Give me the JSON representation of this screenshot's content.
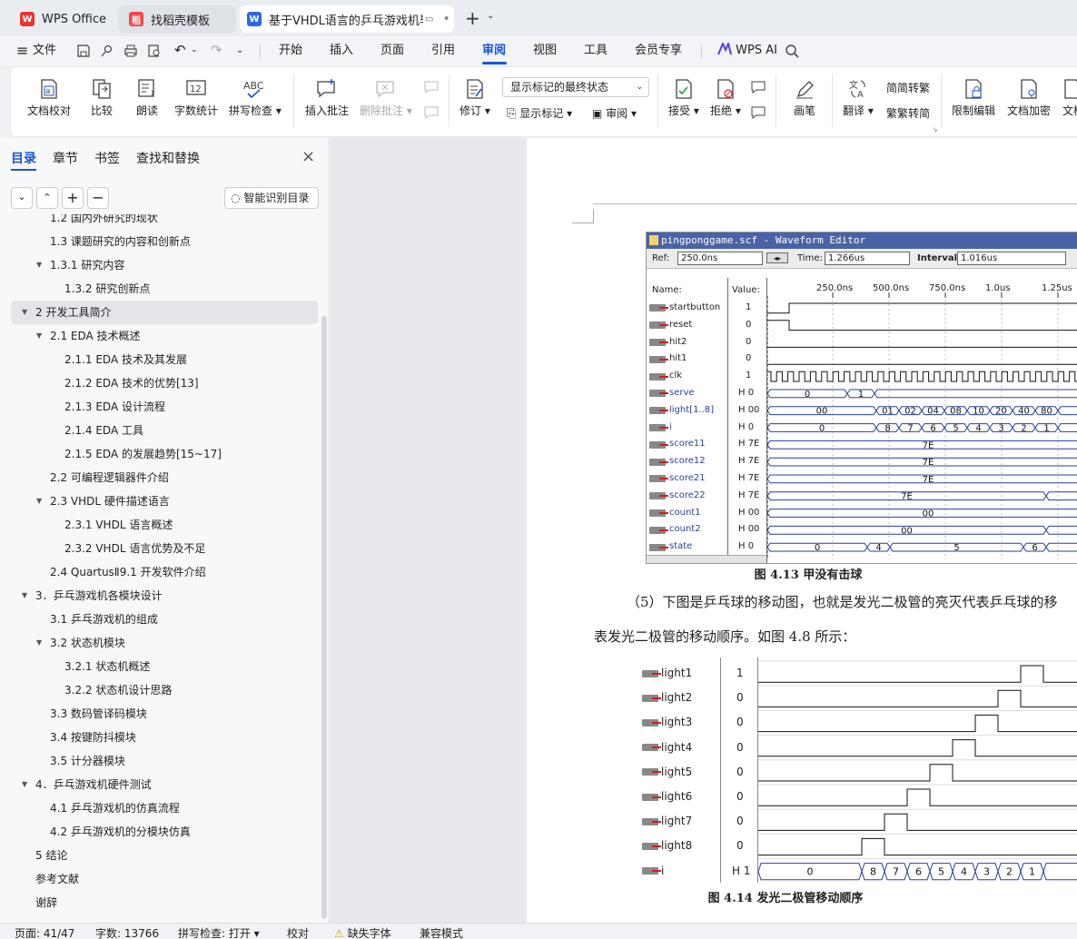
{
  "tabs": [
    {
      "label": "WPS Office",
      "icon": "wps-logo"
    },
    {
      "label": "找稻壳模板",
      "icon": "docer-logo"
    },
    {
      "label": "基于VHDL语言的乒乓游戏机毕",
      "icon": "word-doc"
    }
  ],
  "menu": {
    "file": "文件",
    "items": [
      "开始",
      "插入",
      "页面",
      "引用",
      "审阅",
      "视图",
      "工具",
      "会员专享"
    ],
    "active": "审阅",
    "ai": "WPS AI"
  },
  "ribbon": {
    "doc_check": "文档校对",
    "compare": "比较",
    "read_aloud": "朗读",
    "word_count": "字数统计",
    "spell_check": "拼写检查",
    "insert_comment": "插入批注",
    "delete_comment": "删除批注",
    "track": "修订",
    "markup_dropdown": "显示标记的最终状态",
    "show_markup": "显示标记",
    "review": "审阅",
    "accept": "接受",
    "reject": "拒绝",
    "pen": "画笔",
    "translate": "翻译",
    "to_traditional": "简转繁",
    "to_simplified": "繁转简",
    "restrict": "限制编辑",
    "encrypt": "文档加密",
    "doc_more": "文档"
  },
  "sidebar": {
    "tabs": [
      "目录",
      "章节",
      "书签",
      "查找和替换"
    ],
    "smart_button": "智能识别目录",
    "toc": [
      {
        "label": "1.2 国内外研究的现状",
        "level": 1
      },
      {
        "label": "1.3 课题研究的内容和创新点",
        "level": 1
      },
      {
        "label": "1.3.1  研究内容",
        "level": 1,
        "exp": true
      },
      {
        "label": "1.3.2  研究创新点",
        "level": 2
      },
      {
        "label": "2  开发工具简介",
        "level": 0,
        "exp": true
      },
      {
        "label": "2.1 EDA 技术概述",
        "level": 1,
        "exp": true
      },
      {
        "label": "2.1.1 EDA 技术及其发展",
        "level": 2
      },
      {
        "label": "2.1.2 EDA 技术的优势[13]",
        "level": 2
      },
      {
        "label": "2.1.3 EDA 设计流程",
        "level": 2
      },
      {
        "label": "2.1.4 EDA 工具",
        "level": 2
      },
      {
        "label": "2.1.5 EDA 的发展趋势[15~17]",
        "level": 2
      },
      {
        "label": "2.2 可编程逻辑器件介绍",
        "level": 1
      },
      {
        "label": "2.3 VHDL 硬件描述语言",
        "level": 1,
        "exp": true
      },
      {
        "label": "2.3.1 VHDL 语言概述",
        "level": 2
      },
      {
        "label": "2.3.2 VHDL 语言优势及不足",
        "level": 2
      },
      {
        "label": "2.4 QuartusⅡ9.1 开发软件介绍",
        "level": 1
      },
      {
        "label": "3．乒乓游戏机各模块设计",
        "level": 0,
        "exp": true
      },
      {
        "label": "3.1 乒乓游戏机的组成",
        "level": 1
      },
      {
        "label": "3.2 状态机模块",
        "level": 1,
        "exp": true
      },
      {
        "label": "3.2.1  状态机概述",
        "level": 2
      },
      {
        "label": "3.2.2  状态机设计思路",
        "level": 2
      },
      {
        "label": "3.3 数码管译码模块",
        "level": 1
      },
      {
        "label": "3.4 按键防抖模块",
        "level": 1
      },
      {
        "label": "3.5 计分器模块",
        "level": 1
      },
      {
        "label": "4．乒乓游戏机硬件测试",
        "level": 0,
        "exp": true
      },
      {
        "label": "4.1 乒乓游戏机的仿真流程",
        "level": 1
      },
      {
        "label": "4.2 乒乓游戏机的分模块仿真",
        "level": 1
      },
      {
        "label": "5  结论",
        "level": 0
      },
      {
        "label": "参考文献",
        "level": 0
      },
      {
        "label": "谢辞",
        "level": 0
      }
    ]
  },
  "waveform": {
    "title": "pingponggame.scf - Waveform Editor",
    "ref_label": "Ref:",
    "ref_value": "250.0ns",
    "time_label": "Time:",
    "time_value": "1.266us",
    "interval_label": "Interval:",
    "interval_value": "1.016us",
    "name_col": "Name:",
    "value_col": "Value:",
    "ticks": [
      "250.0ns",
      "500.0ns",
      "750.0ns",
      "1.0us",
      "1.25us"
    ],
    "signals": [
      {
        "name": "startbutton",
        "value": "1"
      },
      {
        "name": "reset",
        "value": "0"
      },
      {
        "name": "hit2",
        "value": "0"
      },
      {
        "name": "hit1",
        "value": "0"
      },
      {
        "name": "clk",
        "value": "1"
      },
      {
        "name": "serve",
        "value": "H 0"
      },
      {
        "name": "light[1..8]",
        "value": "H 00"
      },
      {
        "name": "i",
        "value": "H 0"
      },
      {
        "name": "score11",
        "value": "H 7E"
      },
      {
        "name": "score12",
        "value": "H 7E"
      },
      {
        "name": "score21",
        "value": "H 7E"
      },
      {
        "name": "score22",
        "value": "H 7E"
      },
      {
        "name": "count1",
        "value": "H 00"
      },
      {
        "name": "count2",
        "value": "H 00"
      },
      {
        "name": "state",
        "value": "H 0"
      }
    ],
    "serve_vals": [
      "0",
      "1"
    ],
    "light_vals": [
      "00",
      "01",
      "02",
      "04",
      "08",
      "10",
      "20",
      "40",
      "80"
    ],
    "i_vals": [
      "0",
      "8",
      "7",
      "6",
      "5",
      "4",
      "3",
      "2",
      "1"
    ],
    "score_val": "7E",
    "count_val": "00",
    "state_vals": [
      "0",
      "4",
      "5",
      "6"
    ]
  },
  "caption1": "图 4.13 甲没有击球",
  "para_line1": "（5）下图是乒乓球的移动图，也就是发光二极管的亮灭代表乒乓球的移",
  "para_line2": "表发光二极管的移动顺序。如图 4.8 所示：",
  "lights": {
    "signals": [
      {
        "name": "light1",
        "value": "1"
      },
      {
        "name": "light2",
        "value": "0"
      },
      {
        "name": "light3",
        "value": "0"
      },
      {
        "name": "light4",
        "value": "0"
      },
      {
        "name": "light5",
        "value": "0"
      },
      {
        "name": "light6",
        "value": "0"
      },
      {
        "name": "light7",
        "value": "0"
      },
      {
        "name": "light8",
        "value": "0"
      },
      {
        "name": "i",
        "value": "H 1"
      }
    ],
    "i_vals": [
      "0",
      "8",
      "7",
      "6",
      "5",
      "4",
      "3",
      "2",
      "1"
    ]
  },
  "caption2": "图 4.14 发光二极管移动顺序",
  "status": {
    "page": "页面: 41/47",
    "words": "字数: 13766",
    "spell": "拼写检查: 打开",
    "proof": "校对",
    "missing_font": "缺失字体",
    "compat": "兼容模式"
  }
}
